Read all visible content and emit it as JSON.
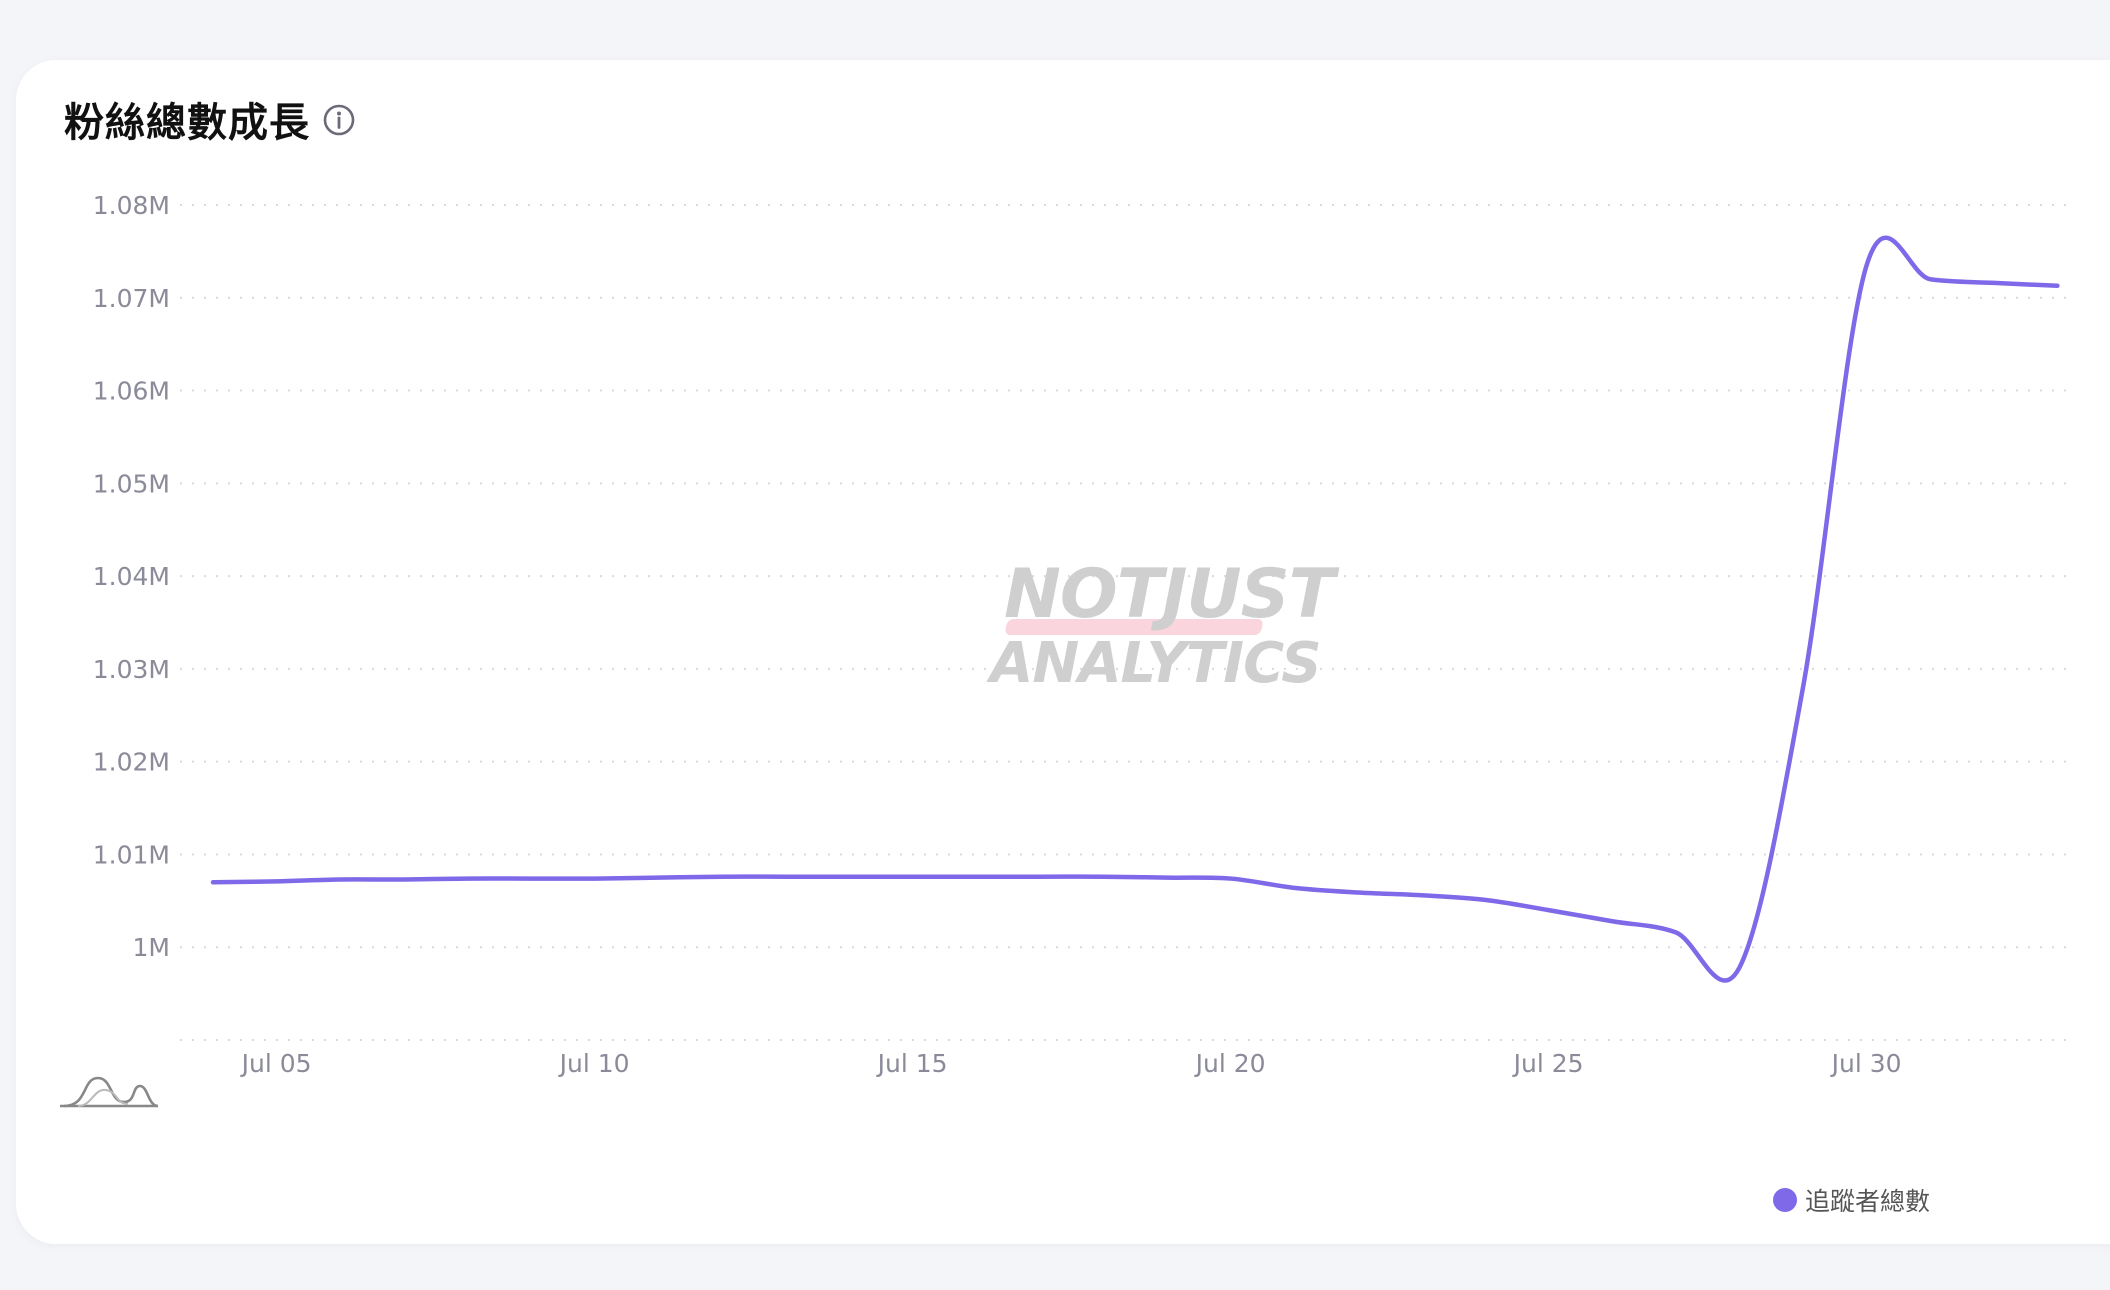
{
  "card": {
    "title": "粉絲總數成長"
  },
  "icons": {
    "info": "info-circle-icon",
    "smoothing": "curve-smoothing-icon"
  },
  "watermark": {
    "line1": "NOTJUST",
    "line2": "ANALYTICS"
  },
  "colors": {
    "series": "#7f69e8",
    "grid": "#d9d9e0",
    "tick_text": "#8a8a99"
  },
  "chart_data": {
    "type": "line",
    "title": "粉絲總數成長",
    "xlabel": "",
    "ylabel": "",
    "x_tick_labels": [
      "Jul 05",
      "Jul 10",
      "Jul 15",
      "Jul 20",
      "Jul 25",
      "Jul 30"
    ],
    "y_tick_labels": [
      "1M",
      "1.01M",
      "1.02M",
      "1.03M",
      "1.04M",
      "1.05M",
      "1.06M",
      "1.07M",
      "1.08M"
    ],
    "y_ticks": [
      1000000,
      1010000,
      1020000,
      1030000,
      1040000,
      1050000,
      1060000,
      1070000,
      1080000
    ],
    "ylim": [
      990000,
      1080000
    ],
    "grid": true,
    "legend_position": "bottom-right",
    "series": [
      {
        "name": "追蹤者總數",
        "x": [
          "Jul 04",
          "Jul 05",
          "Jul 06",
          "Jul 07",
          "Jul 08",
          "Jul 09",
          "Jul 10",
          "Jul 11",
          "Jul 12",
          "Jul 13",
          "Jul 14",
          "Jul 15",
          "Jul 16",
          "Jul 17",
          "Jul 18",
          "Jul 19",
          "Jul 20",
          "Jul 21",
          "Jul 22",
          "Jul 23",
          "Jul 24",
          "Jul 25",
          "Jul 26",
          "Jul 27",
          "Jul 28",
          "Jul 29",
          "Jul 30",
          "Jul 31",
          "Aug 01",
          "Aug 02"
        ],
        "values": [
          1007000,
          1007100,
          1007300,
          1007300,
          1007400,
          1007400,
          1007400,
          1007500,
          1007600,
          1007600,
          1007600,
          1007600,
          1007600,
          1007600,
          1007600,
          1007500,
          1007400,
          1006400,
          1005900,
          1005600,
          1005100,
          1004000,
          1002800,
          1001600,
          997800,
          1028000,
          1073500,
          1072000,
          1071600,
          1071300
        ]
      }
    ]
  },
  "legend": {
    "items": [
      {
        "label": "追蹤者總數",
        "color": "#7f69e8"
      }
    ]
  }
}
